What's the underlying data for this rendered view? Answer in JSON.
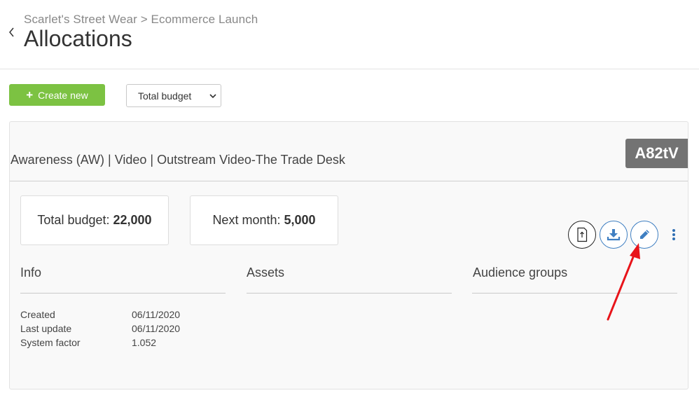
{
  "header": {
    "breadcrumb": "Scarlet's Street Wear > Ecommerce Launch",
    "title": "Allocations"
  },
  "toolbar": {
    "create_label": "Create new",
    "budget_select_value": "Total budget"
  },
  "card": {
    "title": "Awareness (AW) | Video | Outstream Video-The Trade Desk",
    "code": "A82tV",
    "total_budget_label": "Total budget:",
    "total_budget_value": "22,000",
    "next_month_label": "Next month:",
    "next_month_value": "5,000",
    "sections": {
      "info": "Info",
      "assets": "Assets",
      "audience_groups": "Audience groups"
    },
    "info_rows": [
      {
        "label": "Created",
        "value": "06/11/2020"
      },
      {
        "label": "Last update",
        "value": "06/11/2020"
      },
      {
        "label": "System factor",
        "value": "1.052"
      }
    ]
  },
  "icons": {
    "back": "chevron-left-icon",
    "create": "plus-icon",
    "select": "caret-down-icon",
    "upload": "upload-document-icon",
    "download": "download-icon",
    "edit": "pencil-icon",
    "more": "vertical-ellipsis-icon",
    "annotation": "red-arrow-annotation"
  },
  "colors": {
    "primary_green": "#7cc242",
    "action_blue": "#3f7fc2",
    "badge_gray": "#737373",
    "annotation_red": "#e8141a"
  }
}
